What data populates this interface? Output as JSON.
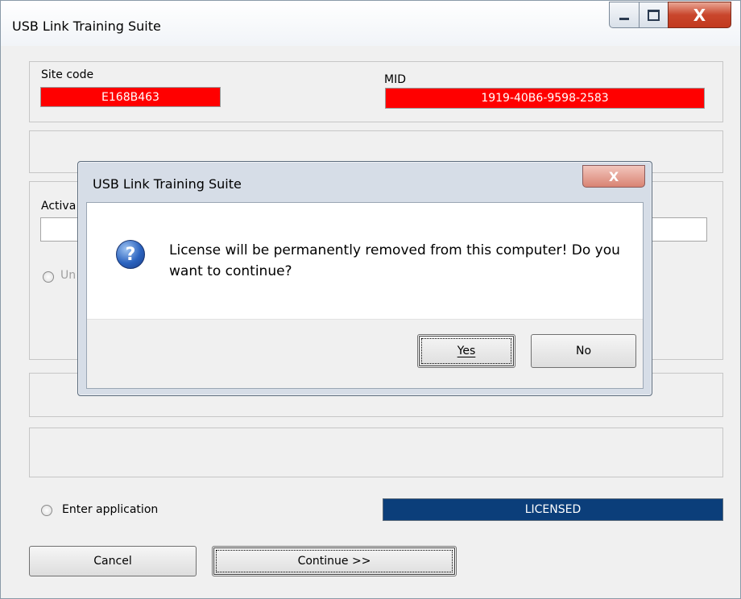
{
  "window": {
    "title": "USB Link Training Suite",
    "controls": {
      "minimize": "minimize-icon",
      "maximize": "maximize-icon",
      "close": "X"
    }
  },
  "site": {
    "site_code_label": "Site code",
    "site_code_value": "E168B463",
    "mid_label": "MID",
    "mid_value": "1919-40B6-9598-2583",
    "field_color": "#ff0000"
  },
  "activation": {
    "label_partial": "Activa",
    "radio_partial": "Un"
  },
  "bottom": {
    "enter_application_label": "Enter application",
    "status_label": "LICENSED",
    "status_color": "#0b3e7a",
    "cancel_label": "Cancel",
    "continue_label": "Continue >>"
  },
  "dialog": {
    "title": "USB Link Training Suite",
    "close_label": "X",
    "icon": "question-icon",
    "message": "License will be permanently removed from this computer! Do you want to continue?",
    "yes_label": "Yes",
    "no_label": "No"
  }
}
